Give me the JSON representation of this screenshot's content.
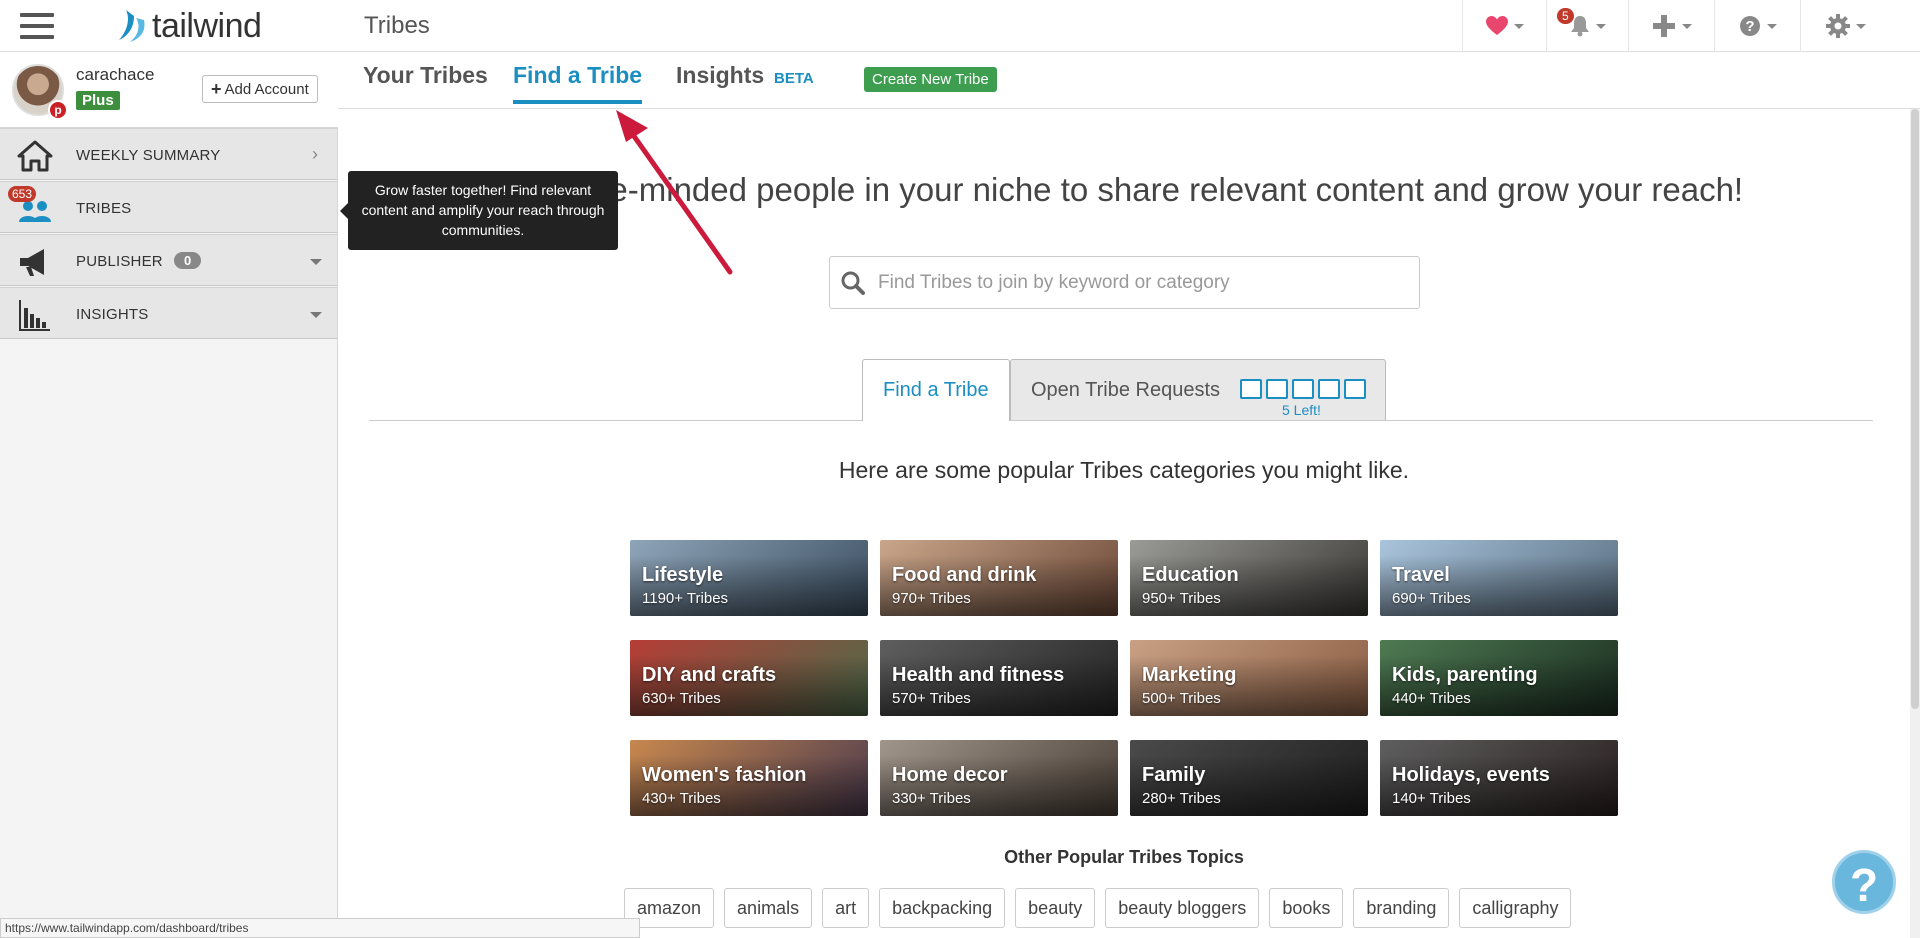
{
  "app": {
    "name": "tailwind",
    "page_title": "Tribes"
  },
  "account": {
    "username": "carachace",
    "plan": "Plus",
    "add_account_label": "Add Account",
    "pin_badge": "p"
  },
  "sidebar": {
    "items": [
      {
        "label": "WEEKLY SUMMARY",
        "badge": ""
      },
      {
        "label": "TRIBES",
        "badge": "653"
      },
      {
        "label": "PUBLISHER",
        "badge": "0"
      },
      {
        "label": "INSIGHTS",
        "badge": ""
      }
    ],
    "tooltip": "Grow faster together! Find relevant content and amplify your reach through communities."
  },
  "header": {
    "notification_count": "5"
  },
  "tabs": {
    "your_tribes": "Your Tribes",
    "find_tribe": "Find a Tribe",
    "insights": "Insights",
    "beta": "BETA",
    "create_label": "Create New Tribe"
  },
  "main": {
    "headline": "Find like-minded people in your niche to share relevant content and grow your reach!",
    "search_placeholder": "Find Tribes to join by keyword or category",
    "content_tabs": {
      "find": "Find a Tribe",
      "open_requests": "Open Tribe Requests",
      "slots_left": "5 Left!"
    },
    "categories_heading": "Here are some popular Tribes categories you might like.",
    "categories": [
      {
        "name": "Lifestyle",
        "count": "1190+ Tribes",
        "color1": "#8ea4b8",
        "color2": "#3c4f61"
      },
      {
        "name": "Food and drink",
        "count": "970+ Tribes",
        "color1": "#c9a58a",
        "color2": "#6d4a38"
      },
      {
        "name": "Education",
        "count": "950+ Tribes",
        "color1": "#9a9a96",
        "color2": "#3b3a37"
      },
      {
        "name": "Travel",
        "count": "690+ Tribes",
        "color1": "#a9c4dc",
        "color2": "#5a6f82"
      },
      {
        "name": "DIY and crafts",
        "count": "630+ Tribes",
        "color1": "#b53d36",
        "color2": "#4e6b4a"
      },
      {
        "name": "Health and fitness",
        "count": "570+ Tribes",
        "color1": "#5e5e5e",
        "color2": "#262626"
      },
      {
        "name": "Marketing",
        "count": "500+ Tribes",
        "color1": "#c9a084",
        "color2": "#8a5e44"
      },
      {
        "name": "Kids, parenting",
        "count": "440+ Tribes",
        "color1": "#4e7a52",
        "color2": "#1c2f22"
      },
      {
        "name": "Women's fashion",
        "count": "430+ Tribes",
        "color1": "#c7874e",
        "color2": "#4b3a4e"
      },
      {
        "name": "Home decor",
        "count": "330+ Tribes",
        "color1": "#a0958a",
        "color2": "#4b4038"
      },
      {
        "name": "Family",
        "count": "280+ Tribes",
        "color1": "#4a4a4a",
        "color2": "#1f1f1f"
      },
      {
        "name": "Holidays, events",
        "count": "140+ Tribes",
        "color1": "#5e5e5e",
        "color2": "#2a2020"
      }
    ],
    "topics_heading": "Other Popular Tribes Topics",
    "topics": [
      "amazon",
      "animals",
      "art",
      "backpacking",
      "beauty",
      "beauty bloggers",
      "books",
      "branding",
      "calligraphy"
    ]
  },
  "status_url": "https://www.tailwindapp.com/dashboard/tribes",
  "colors": {
    "accent": "#1b8ec2",
    "create_button": "#3d9e50",
    "badge_red": "#c0392b",
    "arrow": "#cc1a3d"
  }
}
